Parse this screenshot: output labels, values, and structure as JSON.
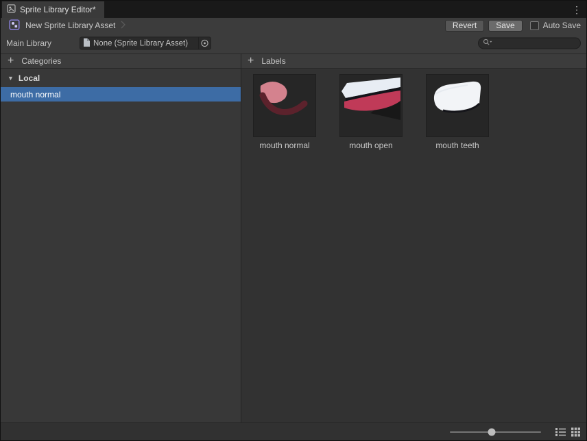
{
  "window": {
    "tab_title": "Sprite Library Editor*"
  },
  "toolbar": {
    "asset_name": "New Sprite Library Asset",
    "revert_label": "Revert",
    "save_label": "Save",
    "auto_save_label": "Auto Save",
    "auto_save_checked": false
  },
  "library_row": {
    "label": "Main Library",
    "object_value": "None (Sprite Library Asset)",
    "search_value": ""
  },
  "categories_panel": {
    "header": "Categories",
    "group_label": "Local",
    "items": [
      {
        "label": "mouth normal",
        "selected": true
      }
    ]
  },
  "labels_panel": {
    "header": "Labels",
    "items": [
      {
        "label": "mouth normal"
      },
      {
        "label": "mouth open"
      },
      {
        "label": "mouth teeth"
      }
    ]
  },
  "bottom_bar": {
    "slider_value": 0.46
  },
  "icons": {
    "window_menu": "⋮",
    "foldout_open": "▼",
    "add": "+"
  },
  "colors": {
    "selection_blue": "#3d6ca5",
    "asset_icon_purple": "#8f83e6"
  }
}
